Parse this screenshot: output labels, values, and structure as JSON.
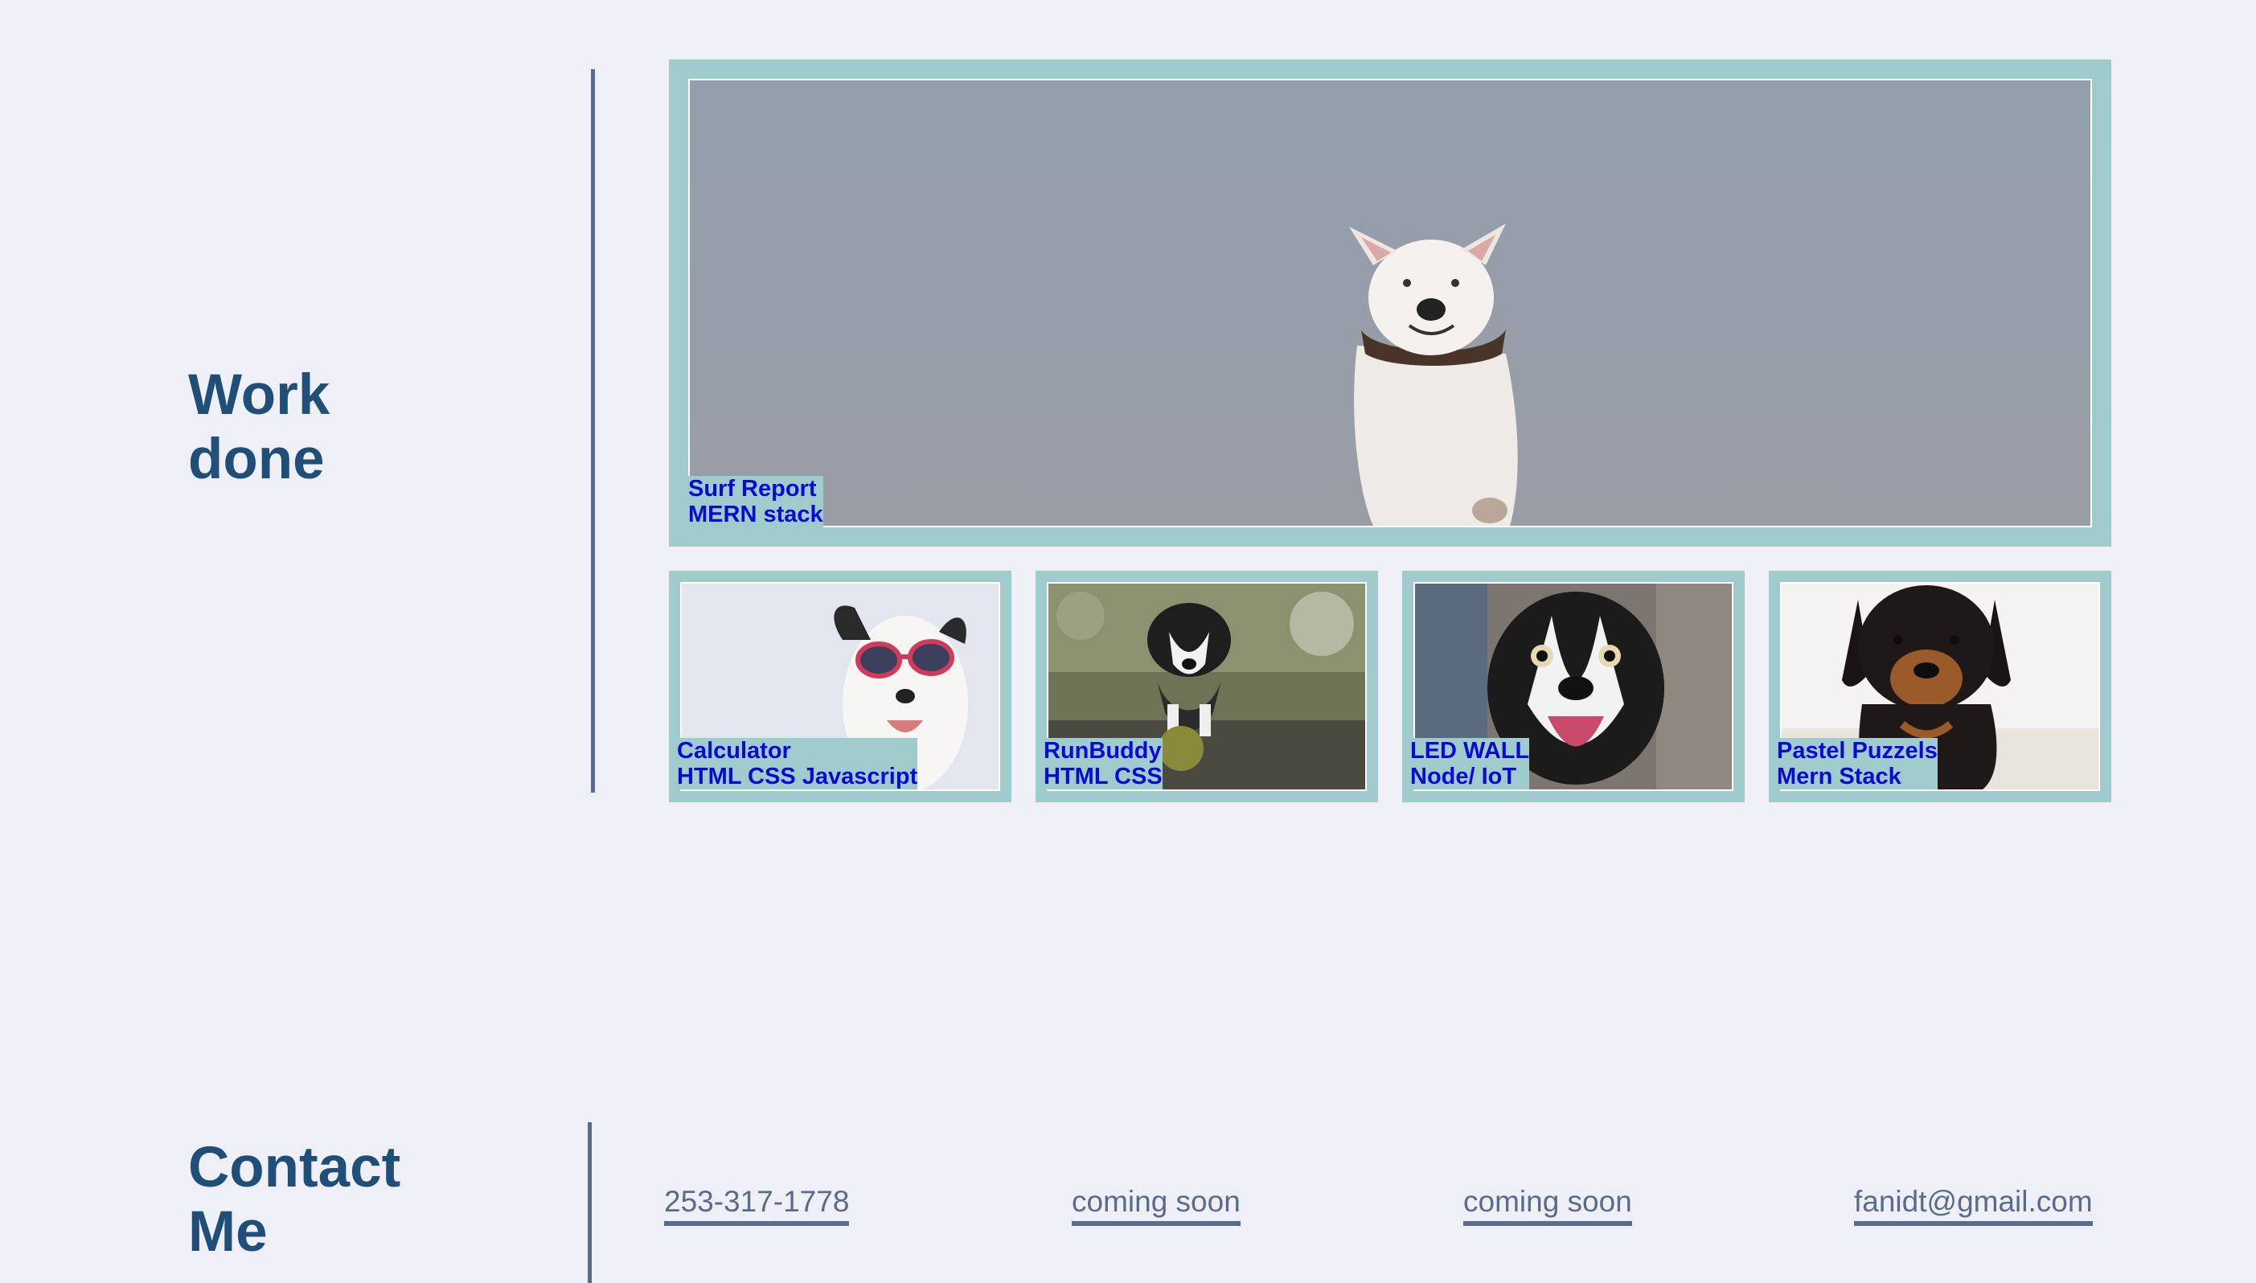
{
  "work": {
    "heading_line1": "Work",
    "heading_line2": "done",
    "featured": {
      "title": "Surf Report",
      "stack": "MERN stack",
      "image": "bull-terrier-dog-photo"
    },
    "projects": [
      {
        "title": "Calculator",
        "stack": "HTML CSS Javascript",
        "image": "dog-with-goggles-photo"
      },
      {
        "title": "RunBuddy",
        "stack": "HTML CSS",
        "image": "border-collie-running-photo"
      },
      {
        "title": "LED WALL",
        "stack": "Node/ IoT",
        "image": "happy-border-collie-photo"
      },
      {
        "title": "Pastel Puzzels",
        "stack": "Mern Stack",
        "image": "rottweiler-puppy-photo"
      }
    ]
  },
  "contact": {
    "heading_line1": "Contact",
    "heading_line2": "Me",
    "links": [
      "253-317-1778",
      "coming soon",
      "coming soon",
      "fanidt@gmail.com"
    ]
  },
  "colors": {
    "background": "#eeeff7",
    "heading": "#1f4e79",
    "card_frame": "#a0cbcd",
    "caption_text": "#0a0ad8",
    "link_text": "#5a6b8c"
  }
}
